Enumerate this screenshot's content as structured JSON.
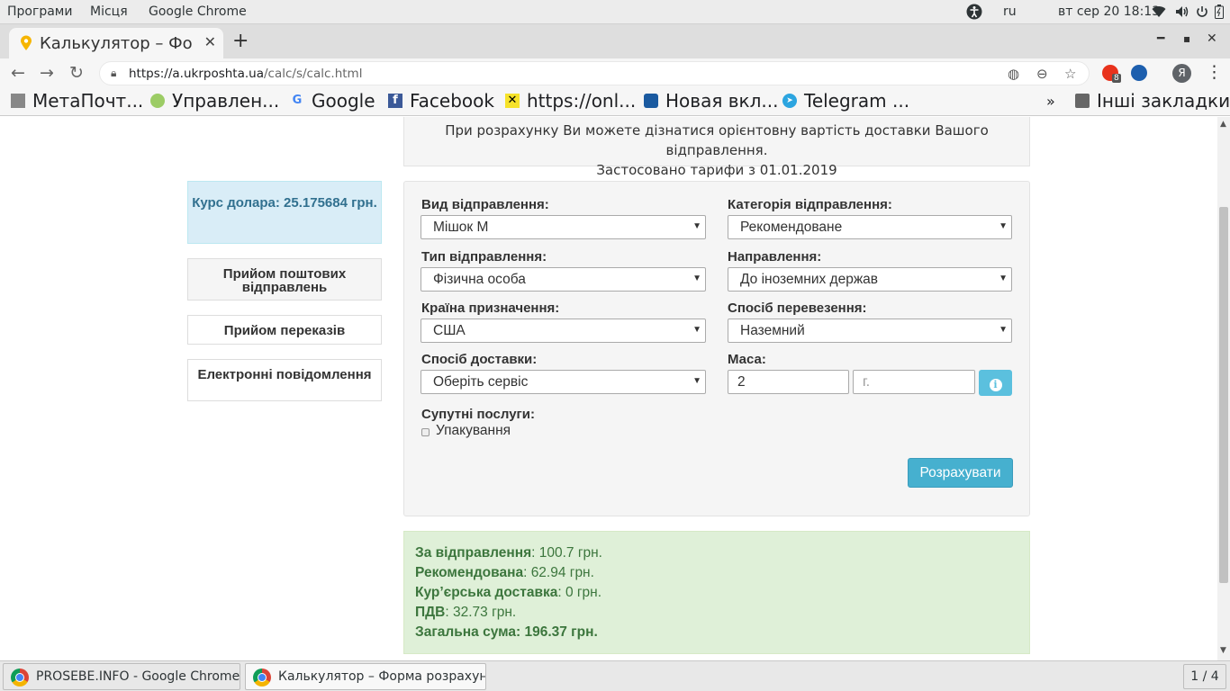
{
  "system_bar": {
    "menu_apps": "Програми",
    "menu_places": "Місця",
    "menu_app": "Google Chrome",
    "lang": "ru",
    "datetime": "вт сер 20  18:13"
  },
  "browser": {
    "tab_title": "Калькулятор – Фо",
    "url_host": "https://a.ukrposhta.ua",
    "url_path": "/calc/s/calc.html",
    "profile_letter": "Я",
    "ext_badge": "8",
    "bookmarks": [
      {
        "label": "МетаПочт..."
      },
      {
        "label": "Управлен..."
      },
      {
        "label": "Google"
      },
      {
        "label": "Facebook"
      },
      {
        "label": "https://onl..."
      },
      {
        "label": "Новая вкл..."
      },
      {
        "label": "Telegram ..."
      }
    ],
    "bookmarks_more": "»",
    "other_bookmarks": "Інші закладки"
  },
  "page": {
    "notice_line1": "При розрахунку Ви можете дізнатися орієнтовну вартість доставки Вашого відправлення.",
    "notice_line2": "Застосовано тарифи з 01.01.2019",
    "rate_text": "Курс долара: 25.175684 грн.",
    "side_buttons": [
      {
        "label": "Прийом поштових відправлень"
      },
      {
        "label": "Прийом переказів"
      },
      {
        "label": "Електронні повідомлення"
      }
    ],
    "form": {
      "shipment_type_label": "Вид відправлення:",
      "shipment_type_value": "Мішок М",
      "category_label": "Категорія відправлення:",
      "category_value": "Рекомендоване",
      "sender_type_label": "Тип відправлення:",
      "sender_type_value": "Фізична особа",
      "direction_label": "Направлення:",
      "direction_value": "До іноземних держав",
      "country_label": "Країна призначення:",
      "country_value": "США",
      "transport_label": "Спосіб перевезення:",
      "transport_value": "Наземний",
      "delivery_label": "Спосіб доставки:",
      "delivery_value": "Оберіть сервіс",
      "mass_label": "Маса:",
      "mass_kg_value": "2",
      "mass_g_placeholder": "г.",
      "extras_label": "Супутні послуги:",
      "packing_label": "Упакування",
      "calculate_button": "Розрахувати"
    },
    "result": {
      "rows": [
        {
          "label": "За відправлення",
          "value": ": 100.7 грн."
        },
        {
          "label": "Рекомендована",
          "value": ": 62.94 грн."
        },
        {
          "label": "Кур’єрська доставка",
          "value": ": 0 грн."
        },
        {
          "label": "ПДВ",
          "value": ": 32.73 грн."
        }
      ],
      "total": "Загальна сума: 196.37 грн."
    }
  },
  "taskbar": {
    "task1": "PROSEBE.INFO - Google Chrome",
    "task2": "Калькулятор – Форма розрахунку...",
    "pager": "1 / 4"
  }
}
